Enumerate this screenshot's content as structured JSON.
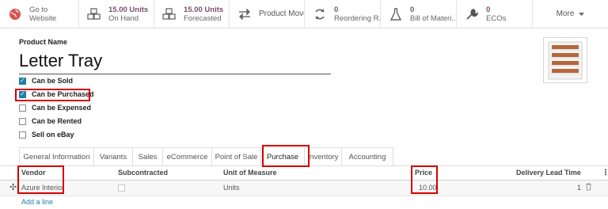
{
  "smart_buttons": [
    {
      "icon": "globe-icon",
      "line1": "Go to",
      "line2": "Website",
      "value_style": false
    },
    {
      "icon": "cubes-icon",
      "line1": "15.00 Units",
      "line2": "On Hand",
      "value_style": true
    },
    {
      "icon": "cubes-icon",
      "line1": "15.00 Units",
      "line2": "Forecasted",
      "value_style": true
    },
    {
      "icon": "exchange-icon",
      "label": "Product Moves"
    },
    {
      "icon": "refresh-icon",
      "line1": "0",
      "line2": "Reordering R...",
      "value_style": true
    },
    {
      "icon": "flask-icon",
      "line1": "0",
      "line2": "Bill of Materi...",
      "value_style": true
    },
    {
      "icon": "wrench-icon",
      "line1": "0",
      "line2": "ECOs",
      "value_style": true
    },
    {
      "label": "More",
      "icon": "caret-down-icon"
    }
  ],
  "form": {
    "product_name_label": "Product Name",
    "product_name": "Letter Tray",
    "image_icon": "letter-tray-image",
    "checkboxes": [
      {
        "label": "Can be Sold",
        "checked": true
      },
      {
        "label": "Can be Purchased",
        "checked": true
      },
      {
        "label": "Can be Expensed",
        "checked": false
      },
      {
        "label": "Can be Rented",
        "checked": false
      },
      {
        "label": "Sell on eBay",
        "checked": false
      }
    ]
  },
  "tabs": [
    {
      "label": "General Information",
      "active": false
    },
    {
      "label": "Variants",
      "active": false
    },
    {
      "label": "Sales",
      "active": false
    },
    {
      "label": "eCommerce",
      "active": false
    },
    {
      "label": "Point of Sale",
      "active": false
    },
    {
      "label": "Purchase",
      "active": true
    },
    {
      "label": "Inventory",
      "active": false
    },
    {
      "label": "Accounting",
      "active": false
    }
  ],
  "vendor_table": {
    "columns": [
      "Vendor",
      "Subcontracted",
      "Unit of Measure",
      "Price",
      "Delivery Lead Time"
    ],
    "rows": [
      {
        "vendor": "Azure Interior",
        "subcontracted": false,
        "uom": "Units",
        "price": "10.00",
        "lead_time": "1"
      }
    ],
    "add_line": "Add a line"
  },
  "colors": {
    "accent": "#7c4c6f",
    "link": "#1f7fa6",
    "highlight": "#d40000",
    "checkbox": "#1f7fa6"
  }
}
